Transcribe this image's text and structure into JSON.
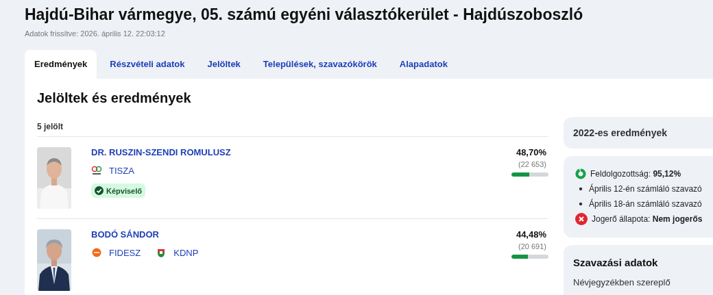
{
  "page": {
    "title": "Hajdú-Bihar vármegye, 05. számú egyéni választókerület - Hajdúszoboszló",
    "updated": "Adatok frissítve: 2026. április 12. 22:03:12"
  },
  "tabs": [
    {
      "label": "Eredmények",
      "selected": true
    },
    {
      "label": "Részvételi adatok",
      "selected": false
    },
    {
      "label": "Jelöltek",
      "selected": false
    },
    {
      "label": "Települések, szavazókörök",
      "selected": false
    },
    {
      "label": "Alapadatok",
      "selected": false
    }
  ],
  "results": {
    "heading": "Jelöltek és eredmények",
    "count": "5 jelölt",
    "candidates": [
      {
        "name": "DR. RUSZIN-SZENDI ROMULUSZ",
        "parties": [
          {
            "name": "TISZA",
            "kind": "loops"
          }
        ],
        "badge": "Képviselő",
        "percent": "48,70%",
        "votes": "(22 653)",
        "level": 0.487
      },
      {
        "name": "BODÓ SÁNDOR",
        "parties": [
          {
            "name": "FIDESZ",
            "kind": "disc"
          },
          {
            "name": "KDNP",
            "kind": "crest"
          }
        ],
        "percent": "44,48%",
        "votes": "(20 691)",
        "level": 0.445
      }
    ]
  },
  "sidebar": {
    "previous": {
      "title": "2022-es eredmények"
    },
    "status": [
      {
        "kind": "progress",
        "text": "Feldolgozottság: **95,12%**"
      },
      {
        "kind": "bullet",
        "text": "Április 12-én számláló szavazó"
      },
      {
        "kind": "bullet",
        "text": "Április 18-án számláló szavazó"
      },
      {
        "kind": "error",
        "text": "Jogerő állapota: **Nem jogerős**"
      }
    ],
    "voting": {
      "title": "Szavazási adatok",
      "text": "Névjegyzékben szereplő"
    }
  }
}
